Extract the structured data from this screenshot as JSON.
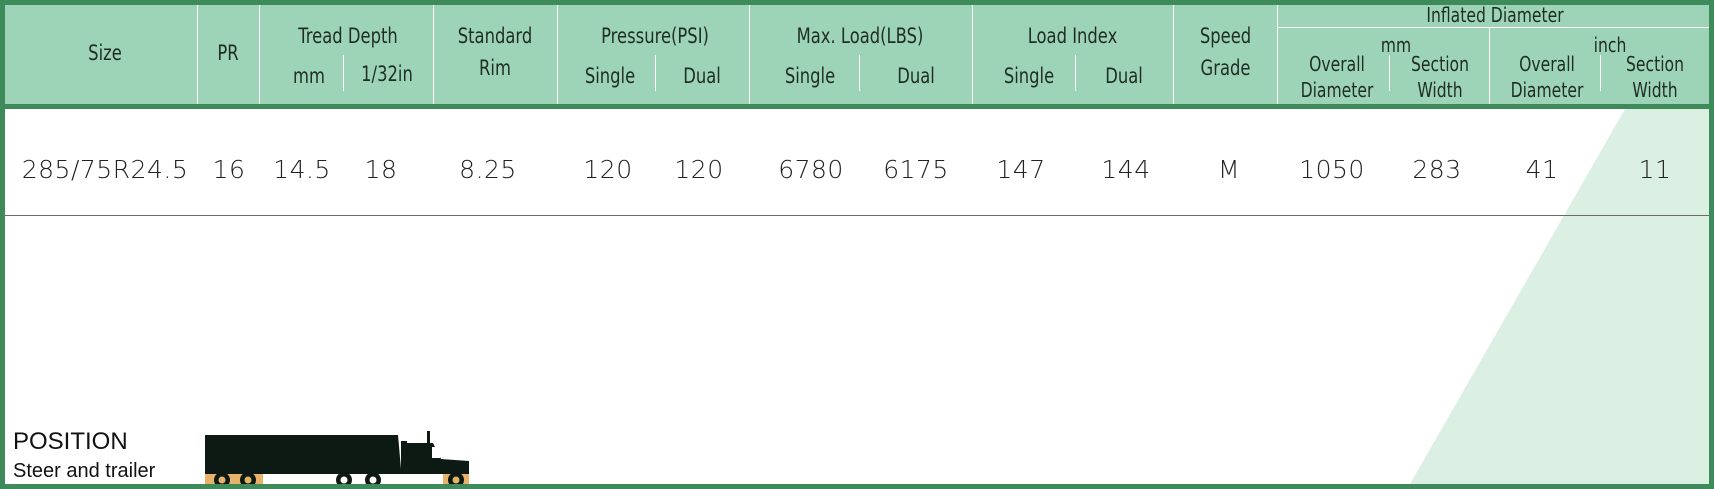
{
  "colors": {
    "header_bg": "#9dd4b7",
    "border": "#3e8a5a",
    "diagonal_band": "#dbefe3",
    "truck": "#0d1a14",
    "wheel_pad": "#e8b26a"
  },
  "header": {
    "size": "Size",
    "pr": "PR",
    "tread_depth": "Tread Depth",
    "tread_mm": "mm",
    "tread_32": "1/32in",
    "standard": "Standard",
    "rim": "Rim",
    "pressure": "Pressure(PSI)",
    "pressure_single": "Single",
    "pressure_dual": "Dual",
    "max_load": "Max. Load(LBS)",
    "load_single": "Single",
    "load_dual": "Dual",
    "load_index": "Load Index",
    "index_single": "Single",
    "index_dual": "Dual",
    "speed": "Speed",
    "grade": "Grade",
    "inflated_diameter": "Inflated  Diameter",
    "unit_mm": "mm",
    "unit_inch": "inch",
    "overall": "Overall",
    "diameter": "Diameter",
    "section": "Section",
    "width": "Width"
  },
  "row": {
    "size": "285/75R24.5",
    "pr": "16",
    "tread_mm": "14.5",
    "tread_32": "18",
    "rim": "8.25",
    "pressure_single": "120",
    "pressure_dual": "120",
    "load_single": "6780",
    "load_dual": "6175",
    "index_single": "147",
    "index_dual": "144",
    "speed": "M",
    "mm_overall": "1050",
    "mm_section": "283",
    "inch_overall": "41",
    "inch_section": "11"
  },
  "position": {
    "title": "POSITION",
    "subtitle": "Steer and trailer",
    "icon": "truck-icon"
  }
}
